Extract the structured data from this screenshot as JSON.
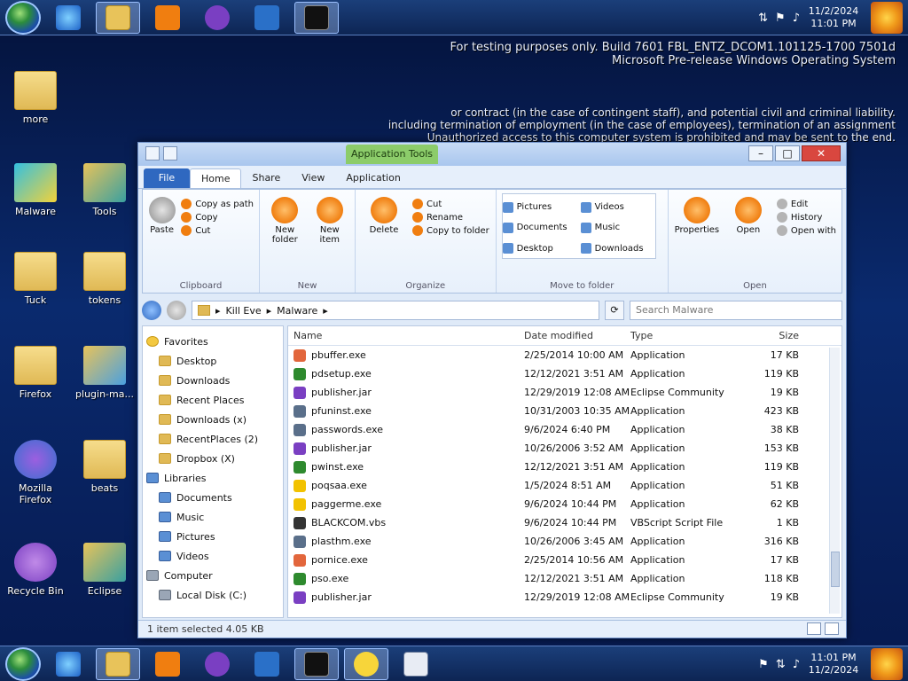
{
  "taskbar": {
    "clock_time": "11:01 PM",
    "clock_date": "11/2/2024",
    "tray_icons": [
      "network-icon",
      "flag-icon",
      "speaker-icon",
      "action-center-icon"
    ]
  },
  "desktop": {
    "icons": [
      {
        "label": "more"
      },
      {
        "label": "Malware"
      },
      {
        "label": "Tuck"
      },
      {
        "label": "Firefox"
      },
      {
        "label": "Mozilla Firefox"
      },
      {
        "label": "Recycle Bin"
      },
      {
        "label": "Tools"
      },
      {
        "label": "tokens"
      },
      {
        "label": "plugin-ma..."
      },
      {
        "label": "beats"
      },
      {
        "label": "Eclipse"
      }
    ]
  },
  "watermark": {
    "line1": "Microsoft Pre-release Windows Operating System",
    "line2": "For testing purposes only. Build 7601 FBL_ENTZ_DCOM1.101125-1700 7501d"
  },
  "bg_text": {
    "line1": "including termination of employment (in the case of employees), termination of an assignment",
    "line2": "or contract (in the case of contingent staff), and potential civil and criminal liability.",
    "line3": "Unauthorized access to this computer system is prohibited and may be sent to the end."
  },
  "window": {
    "context_tab": "Application Tools",
    "file_tab": "File",
    "tabs": [
      "Home",
      "Share",
      "View",
      "Application"
    ],
    "ribbon": {
      "clipboard": {
        "label": "Clipboard",
        "paste": "Paste",
        "copy_path": "Copy as path",
        "copy": "Copy",
        "cut": "Cut"
      },
      "new": {
        "label": "New",
        "new_folder": "New folder",
        "new_item": "New item"
      },
      "organize": {
        "label": "Organize",
        "delete": "Delete",
        "rename": "Rename",
        "cut": "Cut",
        "copy_to": "Copy to folder"
      },
      "move_to": {
        "label": "Move to folder",
        "places": [
          "Pictures",
          "Videos",
          "Documents",
          "Music",
          "Desktop",
          "Downloads"
        ]
      },
      "open": {
        "label": "Open",
        "properties": "Properties",
        "open": "Open",
        "edit": "Edit",
        "history": "History",
        "open_with": "Open with"
      }
    },
    "address": {
      "segments": [
        "Kill Eve",
        "Malware"
      ],
      "search_placeholder": "Search Malware"
    },
    "nav_pane": {
      "favorites": "Favorites",
      "items": [
        "Desktop",
        "Downloads",
        "Recent Places",
        "Downloads (x)",
        "RecentPlaces (2)",
        "Dropbox (X)"
      ],
      "libraries": "Libraries",
      "lib_items": [
        "Documents",
        "Music",
        "Pictures",
        "Videos"
      ],
      "computer": "Computer",
      "local_disk": "Local Disk (C:)"
    },
    "columns": {
      "name": "Name",
      "date": "Date modified",
      "type": "Type",
      "size": "Size"
    },
    "files": [
      {
        "name": "pbuffer.exe",
        "date": "2/25/2014 10:00 AM",
        "type": "Application",
        "size": "17 KB",
        "icon_color": "#e2663c"
      },
      {
        "name": "pdsetup.exe",
        "date": "12/12/2021 3:51 AM",
        "type": "Application",
        "size": "119 KB",
        "icon_color": "#2e8a2e"
      },
      {
        "name": "publisher.jar",
        "date": "12/29/2019 12:08 AM",
        "type": "Eclipse Community",
        "size": "19 KB",
        "icon_color": "#7a3fc2"
      },
      {
        "name": "pfuninst.exe",
        "date": "10/31/2003 10:35 AM",
        "type": "Application",
        "size": "423 KB",
        "icon_color": "#5a6f8a"
      },
      {
        "name": "passwords.exe",
        "date": "9/6/2024 6:40 PM",
        "type": "Application",
        "size": "38 KB",
        "icon_color": "#5a6f8a"
      },
      {
        "name": "publisher.jar",
        "date": "10/26/2006 3:52 AM",
        "type": "Application",
        "size": "153 KB",
        "icon_color": "#7a3fc2"
      },
      {
        "name": "pwinst.exe",
        "date": "12/12/2021 3:51 AM",
        "type": "Application",
        "size": "119 KB",
        "icon_color": "#2e8a2e"
      },
      {
        "name": "poqsaa.exe",
        "date": "1/5/2024 8:51 AM",
        "type": "Application",
        "size": "51 KB",
        "icon_color": "#f2c200"
      },
      {
        "name": "paggerme.exe",
        "date": "9/6/2024 10:44 PM",
        "type": "Application",
        "size": "62 KB",
        "icon_color": "#f2c200"
      },
      {
        "name": "BLACKCOM.vbs",
        "date": "9/6/2024 10:44 PM",
        "type": "VBScript Script File",
        "size": "1 KB",
        "icon_color": "#333333"
      },
      {
        "name": "plasthm.exe",
        "date": "10/26/2006 3:45 AM",
        "type": "Application",
        "size": "316 KB",
        "icon_color": "#5a6f8a"
      },
      {
        "name": "pornice.exe",
        "date": "2/25/2014 10:56 AM",
        "type": "Application",
        "size": "17 KB",
        "icon_color": "#e2663c"
      },
      {
        "name": "pso.exe",
        "date": "12/12/2021 3:51 AM",
        "type": "Application",
        "size": "118 KB",
        "icon_color": "#2e8a2e"
      },
      {
        "name": "publisher.jar",
        "date": "12/29/2019 12:08 AM",
        "type": "Eclipse Community",
        "size": "19 KB",
        "icon_color": "#7a3fc2"
      }
    ],
    "status": "1 item selected  4.05 KB"
  }
}
